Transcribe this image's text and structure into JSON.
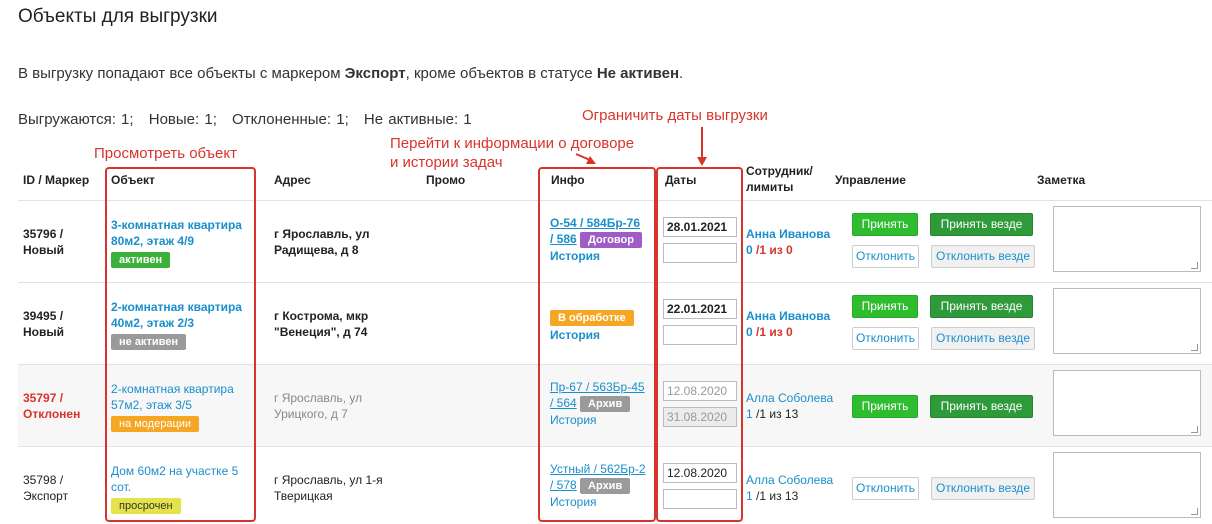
{
  "page": {
    "title": "Объекты для выгрузки",
    "intro_part1": "В выгрузку попадают все объекты с маркером ",
    "intro_bold1": "Экспорт",
    "intro_part2": ", кроме объектов в статусе ",
    "intro_bold2": "Не активен",
    "intro_part3": ".",
    "stats": [
      "Выгружаются: 1;",
      "Новые: 1;",
      "Отклоненные: 1;",
      "Не активные: 1"
    ]
  },
  "annotations": {
    "view_object": "Просмотреть объект",
    "info_line1": "Перейти к информации о договоре",
    "info_line2": "и истории задач",
    "limit_dates": "Ограничить даты выгрузки"
  },
  "columns": {
    "id": "ID / Маркер",
    "object": "Объект",
    "address": "Адрес",
    "promo": "Промо",
    "info": "Инфо",
    "dates": "Даты",
    "staff_line1": "Сотрудник/",
    "staff_line2": "лимиты",
    "manage": "Управление",
    "note": "Заметка"
  },
  "buttons": {
    "accept": "Принять",
    "accept_all": "Принять везде",
    "decline": "Отклонить",
    "decline_all": "Отклонить везде"
  },
  "colors": {
    "accent_link": "#1a8fcc",
    "annotation_red": "#d9342b",
    "badge_active": "#3bb03b",
    "badge_inactive": "#9a9a9a",
    "badge_processing": "#f5a623",
    "badge_expired": "#e4e34a",
    "badge_contract": "#a05cc6"
  },
  "rows": [
    {
      "id": "35796 /",
      "marker": "Новый",
      "object_line1": "3-комнатная квартира",
      "object_line2": "80м2, этаж 4/9",
      "status": "активен",
      "address_line1": "г Ярославль, ул",
      "address_line2": "Радищева, д 8",
      "info_link1": "О-54 / 584Бр-76",
      "info_link2": "/ 586",
      "info_badge": "Договор",
      "history": "История",
      "date_from": "28.01.2021",
      "date_to": "",
      "staff": "Анна Иванова",
      "limit_a": "0",
      "limit_b": " /1 из 0"
    },
    {
      "id": "39495 /",
      "marker": "Новый",
      "object_line1": "2-комнатная квартира",
      "object_line2": "40м2, этаж 2/3",
      "status": "не активен",
      "address_line1": "г Кострома, мкр",
      "address_line2": "\"Венеция\", д 74",
      "info_badge": "В обработке",
      "history": "История",
      "date_from": "22.01.2021",
      "date_to": "",
      "staff": "Анна Иванова",
      "limit_a": "0",
      "limit_b": " /1 из 0"
    },
    {
      "id": "35797 /",
      "marker": "Отклонен",
      "object_line1": "2-комнатная квартира",
      "object_line2": "57м2, этаж 3/5",
      "status": "на модерации",
      "address_line1": "г Ярославль, ул",
      "address_line2": "Урицкого, д 7",
      "info_link1": "Пр-67 / 563Бр-45",
      "info_link2": "/ 564",
      "info_badge": "Архив",
      "history": "История",
      "date_from": "12.08.2020",
      "date_to": "31.08.2020",
      "staff": "Алла Соболева",
      "limit_a": "1",
      "limit_b": " /1 из 13"
    },
    {
      "id": "35798 /",
      "marker": "Экспорт",
      "object_line1": "Дом 60м2 на участке 5",
      "object_line2": "сот.",
      "status": "просрочен",
      "address_line1": "г Ярославль, ул 1-я",
      "address_line2": "Тверицкая",
      "info_link1": "Устный / 562Бр-2",
      "info_link2": "/ 578",
      "info_badge": "Архив",
      "history": "История",
      "date_from": "12.08.2020",
      "date_to": "",
      "staff": "Алла Соболева",
      "limit_a": "1",
      "limit_b": " /1 из 13"
    }
  ]
}
